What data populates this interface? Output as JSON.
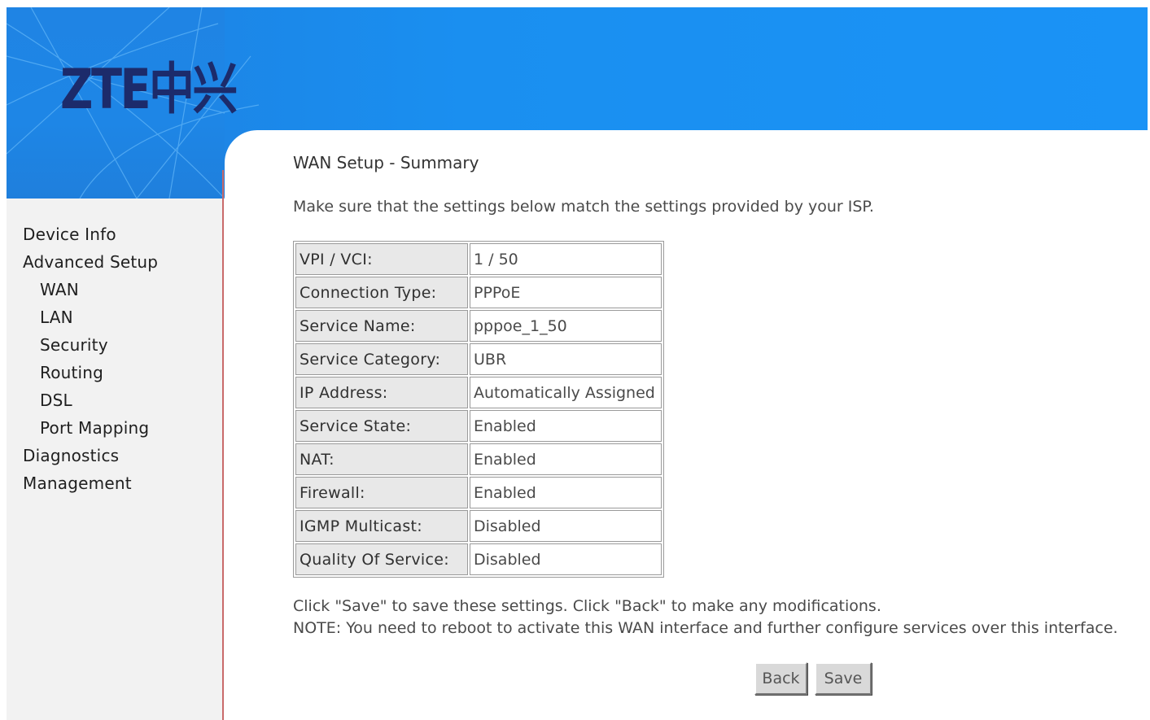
{
  "brand": {
    "logo_text": "ZTE中兴",
    "colors": {
      "banner_blue": "#1a8ff0",
      "logo_navy": "#1c2b6b",
      "sidebar_bg": "#f2f2f2",
      "sidebar_border": "#c96a6a"
    }
  },
  "sidebar": {
    "items": [
      {
        "label": "Device Info",
        "level": 0
      },
      {
        "label": "Advanced Setup",
        "level": 0
      },
      {
        "label": "WAN",
        "level": 1
      },
      {
        "label": "LAN",
        "level": 1
      },
      {
        "label": "Security",
        "level": 1
      },
      {
        "label": "Routing",
        "level": 1
      },
      {
        "label": "DSL",
        "level": 1
      },
      {
        "label": "Port Mapping",
        "level": 1
      },
      {
        "label": "Diagnostics",
        "level": 0
      },
      {
        "label": "Management",
        "level": 0
      }
    ]
  },
  "main": {
    "title": "WAN Setup - Summary",
    "intro": "Make sure that the settings below match the settings provided by your ISP.",
    "summary_rows": [
      {
        "label": "VPI / VCI:",
        "value": "1 / 50"
      },
      {
        "label": "Connection Type:",
        "value": "PPPoE"
      },
      {
        "label": "Service Name:",
        "value": "pppoe_1_50"
      },
      {
        "label": "Service Category:",
        "value": "UBR"
      },
      {
        "label": "IP Address:",
        "value": "Automatically Assigned"
      },
      {
        "label": "Service State:",
        "value": "Enabled"
      },
      {
        "label": "NAT:",
        "value": "Enabled"
      },
      {
        "label": "Firewall:",
        "value": "Enabled"
      },
      {
        "label": "IGMP Multicast:",
        "value": "Disabled"
      },
      {
        "label": "Quality Of Service:",
        "value": "Disabled"
      }
    ],
    "instruction": "Click \"Save\" to save these settings. Click \"Back\" to make any modifications.",
    "note": "NOTE: You need to reboot to activate this WAN interface and further configure services over this interface.",
    "back_label": "Back",
    "save_label": "Save"
  }
}
